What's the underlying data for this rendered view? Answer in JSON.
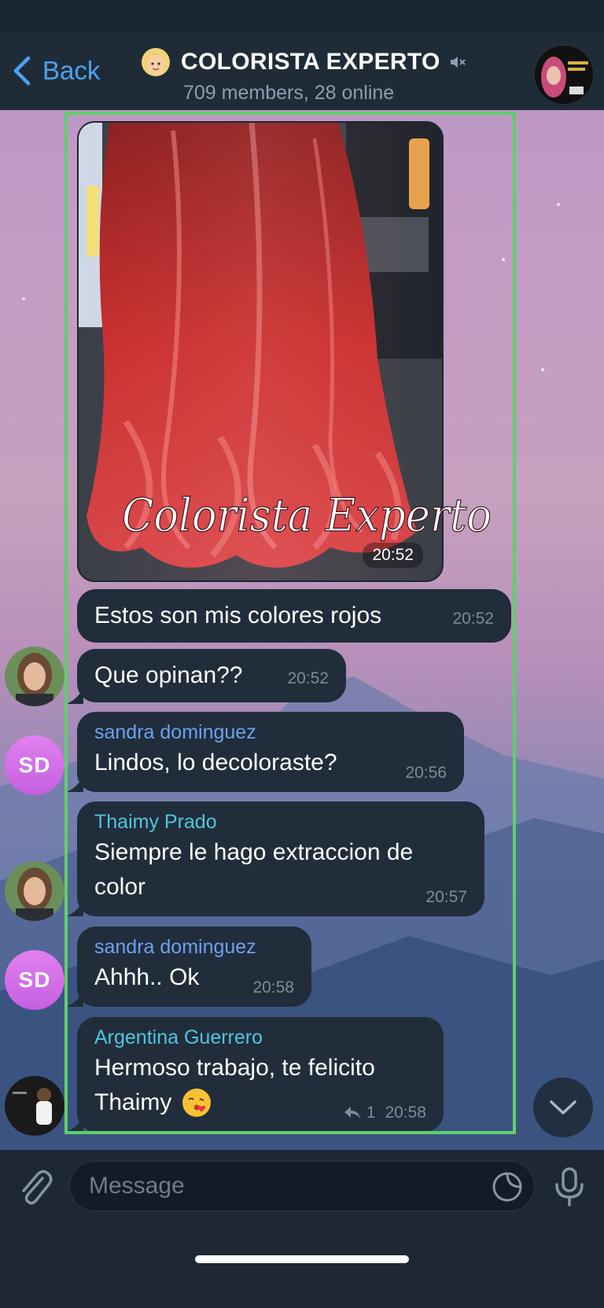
{
  "header": {
    "back_label": "Back",
    "title": "COLORISTA EXPERTO",
    "subtitle": "709 members, 28 online",
    "muted": true
  },
  "messages": [
    {
      "type": "photo",
      "time": "20:52",
      "watermark": "Colorista Experto"
    },
    {
      "type": "text",
      "text": "Estos son mis colores rojos",
      "time": "20:52"
    },
    {
      "type": "text",
      "text": "Que opinan??",
      "time": "20:52"
    },
    {
      "type": "text",
      "sender": "sandra dominguez",
      "sender_color": "#6fa0ef",
      "text": "Lindos, lo decoloraste?",
      "time": "20:56",
      "avatar_initials": "SD"
    },
    {
      "type": "text",
      "sender": "Thaimy Prado",
      "sender_color": "#4fc5dd",
      "text_line1": "Siempre le hago extraccion de",
      "text_line2": "color",
      "time": "20:57"
    },
    {
      "type": "text",
      "sender": "sandra dominguez",
      "sender_color": "#6fa0ef",
      "text": "Ahhh.. Ok",
      "time": "20:58",
      "avatar_initials": "SD"
    },
    {
      "type": "text",
      "sender": "Argentina Guerrero",
      "sender_color": "#4fc5dd",
      "text_line1": "Hermoso trabajo, te felicito",
      "text_line2": "Thaimy",
      "emoji": "kissing-face-emoji",
      "replies": "1",
      "time": "20:58"
    }
  ],
  "input": {
    "placeholder": "Message"
  },
  "colors": {
    "accent": "#4aa3ef",
    "bubble": "#212d3b",
    "highlight": "#5fcf6a",
    "avatar_sd": "#d670ea"
  }
}
